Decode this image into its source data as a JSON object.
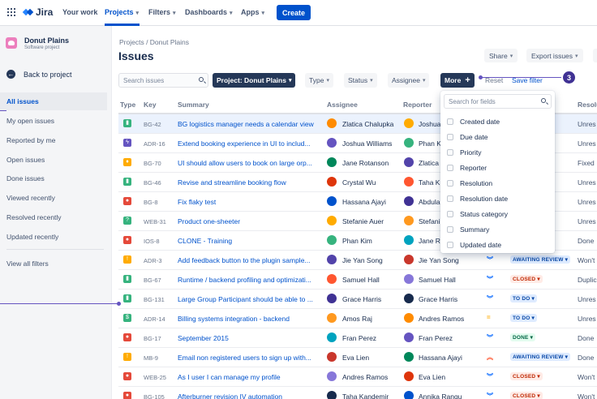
{
  "topnav": {
    "logo": "Jira",
    "items": [
      "Your work",
      "Projects",
      "Filters",
      "Dashboards",
      "Apps"
    ],
    "create_label": "Create"
  },
  "sidebar": {
    "project_name": "Donut Plains",
    "project_type": "Software project",
    "back_label": "Back to project",
    "items": [
      "All issues",
      "My open issues",
      "Reported by me",
      "Open issues",
      "Done issues",
      "Viewed recently",
      "Resolved recently",
      "Updated recently"
    ],
    "view_all": "View all filters"
  },
  "header": {
    "breadcrumb": "Projects / Donut Plains",
    "title": "Issues",
    "share_label": "Share",
    "export_label": "Export issues"
  },
  "filters": {
    "search_placeholder": "Search issues",
    "project_label": "Project: Donut Plains",
    "type_label": "Type",
    "status_label": "Status",
    "assignee_label": "Assignee",
    "more_label": "More",
    "reset_label": "Reset",
    "save_label": "Save filter",
    "callout_number": "3"
  },
  "table": {
    "columns": [
      "Type",
      "Key",
      "Summary",
      "Assignee",
      "Reporter",
      "Resolu"
    ],
    "rows": [
      {
        "type": "story",
        "key": "BG-42",
        "summary": "BG logistics manager needs a calendar view",
        "assignee": "Zlatica Chalupka",
        "reporter": "Joshua",
        "priority": "",
        "status": "",
        "resolution": "Unres"
      },
      {
        "type": "epic",
        "key": "ADR-16",
        "summary": "Extend booking experience in UI to includ...",
        "assignee": "Joshua Williams",
        "reporter": "Phan K",
        "priority": "",
        "status": "",
        "resolution": "Unres"
      },
      {
        "type": "idea",
        "key": "BG-70",
        "summary": "UI should allow users to book on large orp...",
        "assignee": "Jane Rotanson",
        "reporter": "Zlatica",
        "priority": "",
        "status": "",
        "resolution": "Fixed"
      },
      {
        "type": "story",
        "key": "BG-46",
        "summary": "Revise and streamline booking flow",
        "assignee": "Crystal Wu",
        "reporter": "Taha K",
        "priority": "",
        "status": "",
        "resolution": "Unres"
      },
      {
        "type": "bug",
        "key": "BG-8",
        "summary": "Fix flaky test",
        "assignee": "Hassana Ajayi",
        "reporter": "Abdula",
        "priority": "",
        "status": "",
        "resolution": "Unres"
      },
      {
        "type": "question",
        "key": "WEB-31",
        "summary": "Product one-sheeter",
        "assignee": "Stefanie Auer",
        "reporter": "Stefani",
        "priority": "",
        "status": "",
        "resolution": "Unres"
      },
      {
        "type": "bug",
        "key": "IOS-8",
        "summary": "CLONE - Training",
        "assignee": "Phan Kim",
        "reporter": "Jane R",
        "priority": "",
        "status": "",
        "resolution": "Done"
      },
      {
        "type": "task",
        "key": "ADR-3",
        "summary": "Add feedback button to the plugin sample...",
        "assignee": "Jie Yan Song",
        "reporter": "Jie Yan Song",
        "priority": "low",
        "status": "AWAITING REVIEW",
        "resolution": "Won't"
      },
      {
        "type": "story",
        "key": "BG-67",
        "summary": "Runtime / backend profiling and optimizati...",
        "assignee": "Samuel Hall",
        "reporter": "Samuel Hall",
        "priority": "low",
        "status": "CLOSED",
        "resolution": "Duplic"
      },
      {
        "type": "story",
        "key": "BG-131",
        "summary": "Large Group Participant should be able to ...",
        "assignee": "Grace Harris",
        "reporter": "Grace Harris",
        "priority": "low",
        "status": "TO DO",
        "resolution": "Unres"
      },
      {
        "type": "epic-green",
        "key": "ADR-14",
        "summary": "Billing systems integration - backend",
        "assignee": "Amos Raj",
        "reporter": "Andres Ramos",
        "priority": "medium",
        "status": "TO DO",
        "resolution": "Unres"
      },
      {
        "type": "bug",
        "key": "BG-17",
        "summary": "September 2015",
        "assignee": "Fran Perez",
        "reporter": "Fran Perez",
        "priority": "low",
        "status": "DONE",
        "resolution": "Done"
      },
      {
        "type": "task",
        "key": "MB-9",
        "summary": "Email non registered users to sign up with...",
        "assignee": "Eva Lien",
        "reporter": "Hassana Ajayi",
        "priority": "high",
        "status": "AWAITING REVIEW",
        "resolution": "Done"
      },
      {
        "type": "bug",
        "key": "WEB-25",
        "summary": "As I user I can manage my profile",
        "assignee": "Andres Ramos",
        "reporter": "Eva Lien",
        "priority": "low",
        "status": "CLOSED",
        "resolution": "Won't"
      },
      {
        "type": "bug",
        "key": "BG-105",
        "summary": "Afterburner revision IV automation",
        "assignee": "Taha Kandemir",
        "reporter": "Annika Rangu",
        "priority": "low",
        "status": "CLOSED",
        "resolution": "Won't"
      }
    ]
  },
  "more_dropdown": {
    "search_placeholder": "Search for fields",
    "fields": [
      "Created date",
      "Due date",
      "Priority",
      "Reporter",
      "Resolution",
      "Resolution date",
      "Status category",
      "Summary",
      "Updated date"
    ]
  },
  "colors": {
    "brand": "#0052cc",
    "story": "#36b37e",
    "epic": "#6554c0",
    "bug": "#e5493a",
    "task": "#ffab00",
    "idea": "#ffab00",
    "question": "#36b37e"
  }
}
